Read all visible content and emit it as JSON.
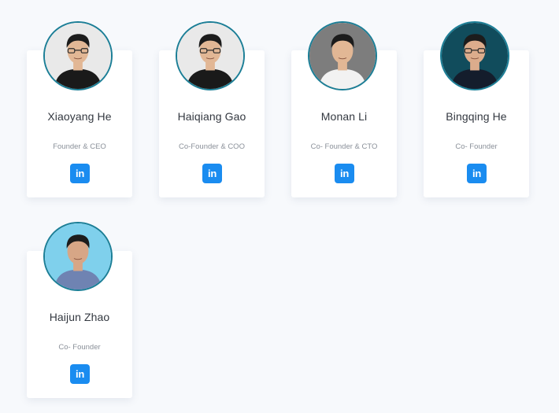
{
  "team": [
    {
      "name": "Xiaoyang He",
      "role": "Founder & CEO",
      "photo_bg": "#e9e9e9",
      "shirt": "#1a1a1a",
      "skin": "#e2b795",
      "glasses": true,
      "linkedin_label": "in"
    },
    {
      "name": "Haiqiang Gao",
      "role": "Co-Founder & COO",
      "photo_bg": "#e9e9e9",
      "shirt": "#1a1a1a",
      "skin": "#e2b795",
      "glasses": true,
      "linkedin_label": "in"
    },
    {
      "name": "Monan Li",
      "role": "Co- Founder & CTO",
      "photo_bg": "#7d7d7d",
      "shirt": "#f2f2f2",
      "skin": "#e2b795",
      "glasses": false,
      "linkedin_label": "in"
    },
    {
      "name": "Bingqing He",
      "role": "Co- Founder",
      "photo_bg": "#114c5c",
      "shirt": "#141d2c",
      "skin": "#dcac8c",
      "glasses": true,
      "linkedin_label": "in"
    },
    {
      "name": "Haijun Zhao",
      "role": "Co- Founder",
      "photo_bg": "#7fd0ec",
      "shirt": "#6f83b2",
      "skin": "#d7a686",
      "glasses": false,
      "linkedin_label": "in"
    }
  ],
  "colors": {
    "page_background": "#f7f9fc",
    "avatar_border": "#1b7e96",
    "linkedin_blue": "#1a8cf0",
    "name_text": "#333840",
    "role_text": "#8a9099"
  },
  "icons": {
    "linkedin": "linkedin-icon"
  }
}
